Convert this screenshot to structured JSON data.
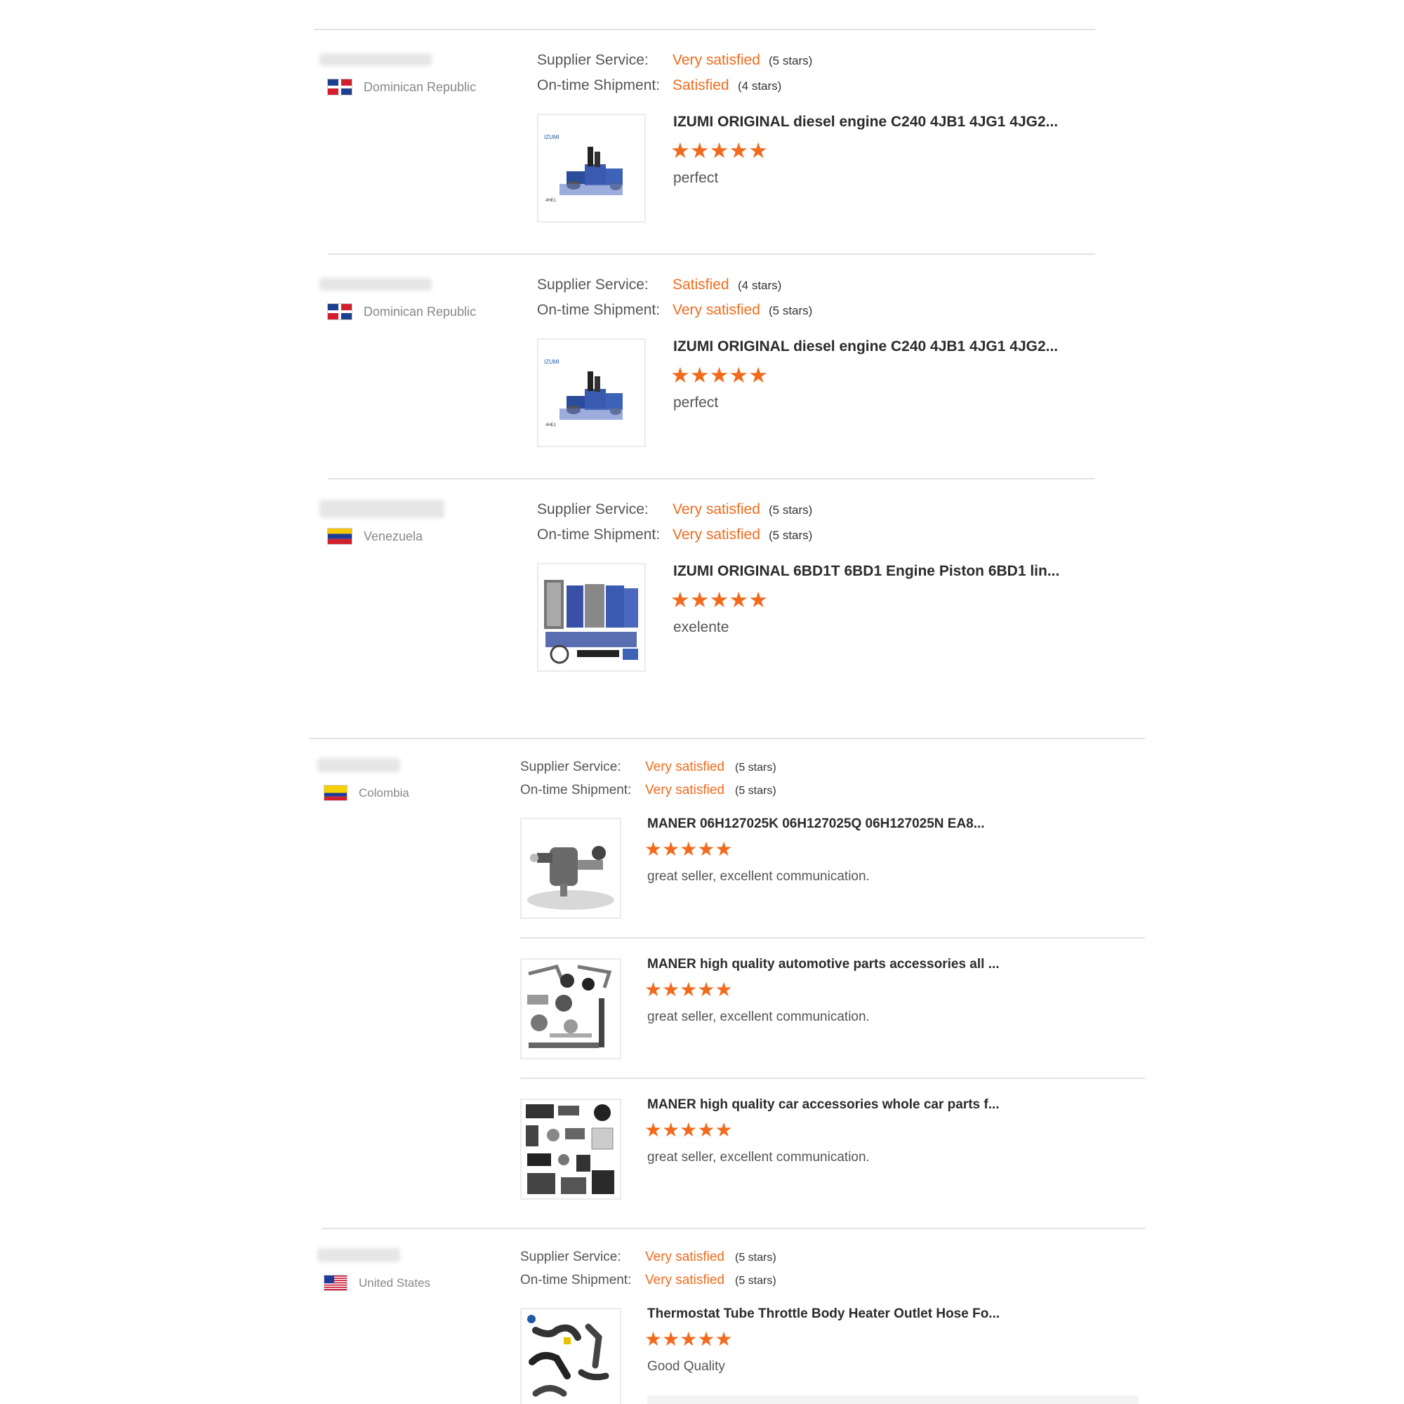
{
  "labels": {
    "supplier": "Supplier Service:",
    "shipment": "On-time Shipment:"
  },
  "colors": {
    "accent": "#f26b1d",
    "divider": "#e2e2e2",
    "label": "#555555"
  },
  "reviews": [
    {
      "country": "Dominican Republic",
      "supplier_rating": "Very satisfied",
      "supplier_stars": "(5 stars)",
      "shipment_rating": "Satisfied",
      "shipment_stars": "(4 stars)",
      "product_title": "IZUMI ORIGINAL diesel engine C240 4JB1 4JG1 4JG2...",
      "product_rating": 5,
      "comment": "perfect",
      "image_icon": "engine-parts-kit-icon"
    },
    {
      "country": "Dominican Republic",
      "supplier_rating": "Satisfied",
      "supplier_stars": "(4 stars)",
      "shipment_rating": "Very satisfied",
      "shipment_stars": "(5 stars)",
      "product_title": "IZUMI ORIGINAL diesel engine C240 4JB1 4JG1 4JG2...",
      "product_rating": 5,
      "comment": "perfect",
      "image_icon": "engine-parts-kit-icon"
    },
    {
      "country": "Venezuela",
      "supplier_rating": "Very satisfied",
      "supplier_stars": "(5 stars)",
      "shipment_rating": "Very satisfied",
      "shipment_stars": "(5 stars)",
      "product_title": "IZUMI ORIGINAL 6BD1T 6BD1 Engine Piston 6BD1 lin...",
      "product_rating": 5,
      "comment": "exelente",
      "image_icon": "piston-liner-kit-icon"
    },
    {
      "country": "Colombia",
      "supplier_rating": "Very satisfied",
      "supplier_stars": "(5 stars)",
      "shipment_rating": "Very satisfied",
      "shipment_stars": "(5 stars)",
      "products": [
        {
          "title": "MANER 06H127025K 06H127025Q 06H127025N EA8...",
          "rating": 5,
          "comment": "great seller, excellent communication.",
          "image_icon": "fuel-pump-icon"
        },
        {
          "title": "MANER high quality automotive parts accessories all ...",
          "rating": 5,
          "comment": "great seller, excellent communication.",
          "image_icon": "suspension-parts-icon"
        },
        {
          "title": "MANER high quality car accessories whole car parts f...",
          "rating": 5,
          "comment": "great seller, excellent communication.",
          "image_icon": "car-parts-collection-icon"
        }
      ]
    },
    {
      "country": "United States",
      "supplier_rating": "Very satisfied",
      "supplier_stars": "(5 stars)",
      "shipment_rating": "Very satisfied",
      "shipment_stars": "(5 stars)",
      "product_title": "Thermostat Tube Throttle Body Heater Outlet Hose Fo...",
      "product_rating": 5,
      "comment": "Good Quality",
      "image_icon": "hose-pipes-icon"
    }
  ]
}
